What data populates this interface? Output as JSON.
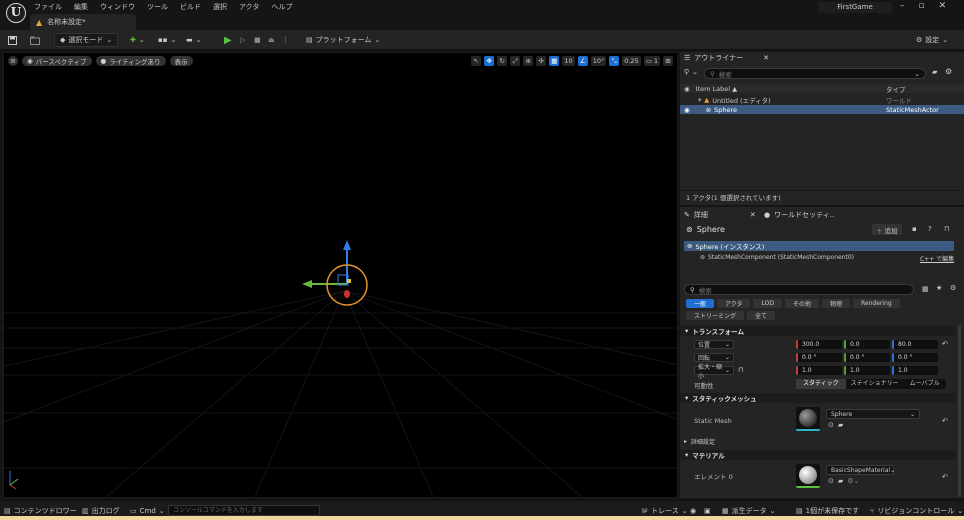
{
  "app": {
    "logo_text": "U",
    "project_name": "FirstGame"
  },
  "menu": [
    "ファイル",
    "編集",
    "ウィンドウ",
    "ツール",
    "ビルド",
    "選択",
    "アクタ",
    "ヘルプ"
  ],
  "window_controls": {
    "minimize": "–",
    "maximize": "▫",
    "close": "✕"
  },
  "document_tab": {
    "label": "名称未設定*"
  },
  "toolbar": {
    "select_mode": "選択モード",
    "platforms": "プラットフォーム",
    "settings": "設定"
  },
  "viewport": {
    "perspective": "パースペクティブ",
    "lighting": "ライティングあり",
    "show": "表示",
    "grid_snap": "10",
    "rotation_snap": "10°",
    "scale_snap": "0.25",
    "camera_speed": "1"
  },
  "outliner": {
    "tab_label": "アウトライナー",
    "search_placeholder": "検索",
    "col_label": "Item Label ▲",
    "col_type": "タイプ",
    "rows": [
      {
        "label": "Untitled (エディタ)",
        "type": "ワールド"
      },
      {
        "label": "Sphere",
        "type": "StaticMeshActor"
      }
    ],
    "footer": "1 アクタ(1 個選択されています)"
  },
  "details": {
    "tab_label": "詳細",
    "tab2_label": "ワールドセッティ..",
    "object_name": "Sphere",
    "add_button": "追加",
    "instance_label": "Sphere (インスタンス)",
    "component_label": "StaticMeshComponent (StaticMeshComponent0)",
    "edit_cpp": "C++ で編集",
    "search_placeholder": "検索",
    "categories": [
      "一般",
      "アクタ",
      "LOD",
      "その他",
      "物理",
      "Rendering",
      "ストリーミング",
      "全て"
    ],
    "transform_section": "トランスフォーム",
    "location_label": "位置",
    "location": [
      "300.0",
      "0.0",
      "80.0"
    ],
    "rotation_label": "回転",
    "rotation": [
      "0.0 °",
      "0.0 °",
      "0.0 °"
    ],
    "scale_label": "拡大・縮小",
    "scale": [
      "1.0",
      "1.0",
      "1.0"
    ],
    "mobility_label": "可動性",
    "mobility_options": [
      "スタティック",
      "ステイショナリー",
      "ムーバブル"
    ],
    "static_mesh_section": "スタティックメッシュ",
    "static_mesh_label": "Static Mesh",
    "static_mesh_value": "Sphere",
    "advanced_section": "詳細設定",
    "material_section": "マテリアル",
    "element_label": "エレメント 0",
    "material_value": "BasicShapeMaterial"
  },
  "statusbar": {
    "content_drawer": "コンテンツドロワー",
    "output_log": "出力ログ",
    "cmd": "Cmd",
    "console_placeholder": "コンソールコマンドを入力します",
    "trace": "トレース",
    "derived_data": "派生データ",
    "unsaved": "1個が未保存です",
    "revision_control": "リビジョンコントロール"
  },
  "colors": {
    "accent": "#1f6fd1",
    "play": "#59c13a",
    "selection": "#3d5b80",
    "gizmo_ring": "#e8922f"
  }
}
